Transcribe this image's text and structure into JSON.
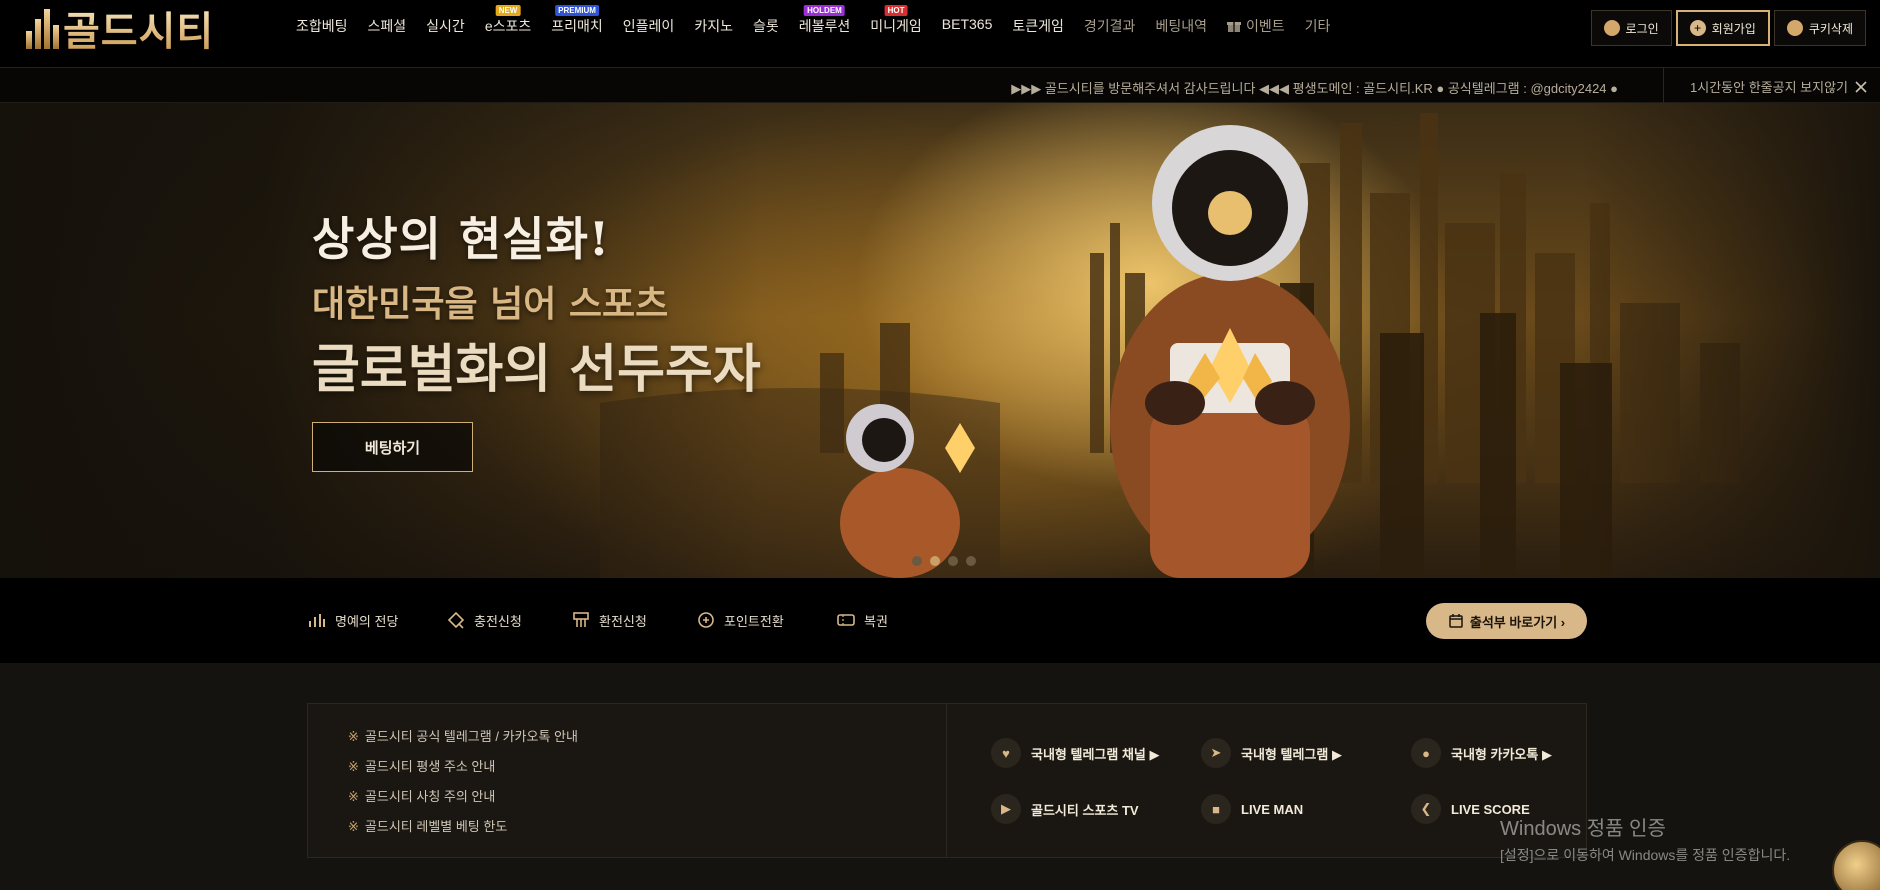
{
  "brand": {
    "logo_text": "골드시티"
  },
  "nav": {
    "items": [
      {
        "label": "조합베팅",
        "badge": ""
      },
      {
        "label": "스페셜",
        "badge": ""
      },
      {
        "label": "실시간",
        "badge": ""
      },
      {
        "label": "e스포츠",
        "badge": "NEW"
      },
      {
        "label": "프리매치",
        "badge": "PREMIUM"
      },
      {
        "label": "인플레이",
        "badge": ""
      },
      {
        "label": "카지노",
        "badge": ""
      },
      {
        "label": "슬롯",
        "badge": ""
      },
      {
        "label": "레볼루션",
        "badge": "HOLDEM"
      },
      {
        "label": "미니게임",
        "badge": "HOT"
      },
      {
        "label": "BET365",
        "badge": ""
      },
      {
        "label": "토큰게임",
        "badge": ""
      },
      {
        "label": "경기결과",
        "badge": ""
      },
      {
        "label": "베팅내역",
        "badge": ""
      },
      {
        "label": "이벤트",
        "badge": ""
      },
      {
        "label": "기타",
        "badge": ""
      }
    ],
    "badge_colors": {
      "NEW": "#e6a81d",
      "PREMIUM": "#2f53d6",
      "HOLDEM": "#9b2fd6",
      "HOT": "#d62f2f"
    }
  },
  "auth": {
    "login": "로그인",
    "signup": "회원가입",
    "clear_cookies": "쿠키삭제"
  },
  "ticker": {
    "text": "▶▶▶ 골드시티를 방문해주셔서 감사드립니다 ◀◀◀ 평생도메인 : 골드시티.KR ● 공식텔레그램 : @gdcity2424 ●",
    "hide_label": "1시간동안 한줄공지 보지않기"
  },
  "hero": {
    "title": "상상의 현실화!",
    "sub1": "대한민국을 넘어 스포츠",
    "sub2": "글로벌화의 선두주자",
    "cta": "베팅하기",
    "slides": 4,
    "active_slide": 2
  },
  "quick": {
    "items": [
      "명예의 전당",
      "충전신청",
      "환전신청",
      "포인트전환",
      "복권"
    ],
    "attendance": "출석부 바로가기 ›"
  },
  "info": {
    "notices": [
      "골드시티 공식 텔레그램 / 카카오톡 안내",
      "골드시티 평생 주소 안내",
      "골드시티 사칭 주의 안내",
      "골드시티 레벨별 베팅 한도"
    ],
    "notice_mark": "※",
    "links": [
      {
        "label": "국내형 텔레그램 채널 ▶",
        "icon": "bell-icon"
      },
      {
        "label": "국내형 텔레그램 ▶",
        "icon": "telegram-icon"
      },
      {
        "label": "국내형 카카오톡 ▶",
        "icon": "kakaotalk-icon"
      },
      {
        "label": "골드시티 스포츠 TV",
        "icon": "video-icon"
      },
      {
        "label": "LIVE MAN",
        "icon": "live-camera-icon"
      },
      {
        "label": "LIVE SCORE",
        "icon": "live-score-icon"
      }
    ]
  },
  "watermark": {
    "line1": "Windows 정품 인증",
    "line2": "[설정]으로 이동하여 Windows를 정품 인증합니다."
  }
}
